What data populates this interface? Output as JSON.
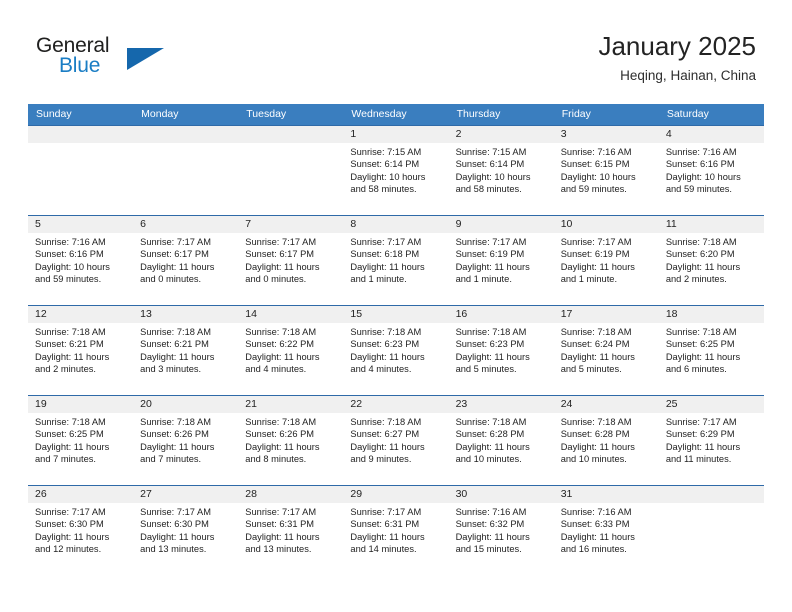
{
  "brand": {
    "name_part1": "General",
    "name_part2": "Blue",
    "triangle_color": "#1567ac",
    "blue_color": "#1a7dc4"
  },
  "header": {
    "title": "January 2025",
    "subtitle": "Heqing, Hainan, China"
  },
  "theme": {
    "header_row_bg": "#3a7ebf",
    "cell_divider": "#2f6aa8",
    "date_band_bg": "#f0f0f0"
  },
  "weekdays": [
    "Sunday",
    "Monday",
    "Tuesday",
    "Wednesday",
    "Thursday",
    "Friday",
    "Saturday"
  ],
  "weeks": [
    [
      {
        "date": "",
        "sunrise": "",
        "sunset": "",
        "daylight_line1": "",
        "daylight_line2": ""
      },
      {
        "date": "",
        "sunrise": "",
        "sunset": "",
        "daylight_line1": "",
        "daylight_line2": ""
      },
      {
        "date": "",
        "sunrise": "",
        "sunset": "",
        "daylight_line1": "",
        "daylight_line2": ""
      },
      {
        "date": "1",
        "sunrise": "Sunrise: 7:15 AM",
        "sunset": "Sunset: 6:14 PM",
        "daylight_line1": "Daylight: 10 hours",
        "daylight_line2": "and 58 minutes."
      },
      {
        "date": "2",
        "sunrise": "Sunrise: 7:15 AM",
        "sunset": "Sunset: 6:14 PM",
        "daylight_line1": "Daylight: 10 hours",
        "daylight_line2": "and 58 minutes."
      },
      {
        "date": "3",
        "sunrise": "Sunrise: 7:16 AM",
        "sunset": "Sunset: 6:15 PM",
        "daylight_line1": "Daylight: 10 hours",
        "daylight_line2": "and 59 minutes."
      },
      {
        "date": "4",
        "sunrise": "Sunrise: 7:16 AM",
        "sunset": "Sunset: 6:16 PM",
        "daylight_line1": "Daylight: 10 hours",
        "daylight_line2": "and 59 minutes."
      }
    ],
    [
      {
        "date": "5",
        "sunrise": "Sunrise: 7:16 AM",
        "sunset": "Sunset: 6:16 PM",
        "daylight_line1": "Daylight: 10 hours",
        "daylight_line2": "and 59 minutes."
      },
      {
        "date": "6",
        "sunrise": "Sunrise: 7:17 AM",
        "sunset": "Sunset: 6:17 PM",
        "daylight_line1": "Daylight: 11 hours",
        "daylight_line2": "and 0 minutes."
      },
      {
        "date": "7",
        "sunrise": "Sunrise: 7:17 AM",
        "sunset": "Sunset: 6:17 PM",
        "daylight_line1": "Daylight: 11 hours",
        "daylight_line2": "and 0 minutes."
      },
      {
        "date": "8",
        "sunrise": "Sunrise: 7:17 AM",
        "sunset": "Sunset: 6:18 PM",
        "daylight_line1": "Daylight: 11 hours",
        "daylight_line2": "and 1 minute."
      },
      {
        "date": "9",
        "sunrise": "Sunrise: 7:17 AM",
        "sunset": "Sunset: 6:19 PM",
        "daylight_line1": "Daylight: 11 hours",
        "daylight_line2": "and 1 minute."
      },
      {
        "date": "10",
        "sunrise": "Sunrise: 7:17 AM",
        "sunset": "Sunset: 6:19 PM",
        "daylight_line1": "Daylight: 11 hours",
        "daylight_line2": "and 1 minute."
      },
      {
        "date": "11",
        "sunrise": "Sunrise: 7:18 AM",
        "sunset": "Sunset: 6:20 PM",
        "daylight_line1": "Daylight: 11 hours",
        "daylight_line2": "and 2 minutes."
      }
    ],
    [
      {
        "date": "12",
        "sunrise": "Sunrise: 7:18 AM",
        "sunset": "Sunset: 6:21 PM",
        "daylight_line1": "Daylight: 11 hours",
        "daylight_line2": "and 2 minutes."
      },
      {
        "date": "13",
        "sunrise": "Sunrise: 7:18 AM",
        "sunset": "Sunset: 6:21 PM",
        "daylight_line1": "Daylight: 11 hours",
        "daylight_line2": "and 3 minutes."
      },
      {
        "date": "14",
        "sunrise": "Sunrise: 7:18 AM",
        "sunset": "Sunset: 6:22 PM",
        "daylight_line1": "Daylight: 11 hours",
        "daylight_line2": "and 4 minutes."
      },
      {
        "date": "15",
        "sunrise": "Sunrise: 7:18 AM",
        "sunset": "Sunset: 6:23 PM",
        "daylight_line1": "Daylight: 11 hours",
        "daylight_line2": "and 4 minutes."
      },
      {
        "date": "16",
        "sunrise": "Sunrise: 7:18 AM",
        "sunset": "Sunset: 6:23 PM",
        "daylight_line1": "Daylight: 11 hours",
        "daylight_line2": "and 5 minutes."
      },
      {
        "date": "17",
        "sunrise": "Sunrise: 7:18 AM",
        "sunset": "Sunset: 6:24 PM",
        "daylight_line1": "Daylight: 11 hours",
        "daylight_line2": "and 5 minutes."
      },
      {
        "date": "18",
        "sunrise": "Sunrise: 7:18 AM",
        "sunset": "Sunset: 6:25 PM",
        "daylight_line1": "Daylight: 11 hours",
        "daylight_line2": "and 6 minutes."
      }
    ],
    [
      {
        "date": "19",
        "sunrise": "Sunrise: 7:18 AM",
        "sunset": "Sunset: 6:25 PM",
        "daylight_line1": "Daylight: 11 hours",
        "daylight_line2": "and 7 minutes."
      },
      {
        "date": "20",
        "sunrise": "Sunrise: 7:18 AM",
        "sunset": "Sunset: 6:26 PM",
        "daylight_line1": "Daylight: 11 hours",
        "daylight_line2": "and 7 minutes."
      },
      {
        "date": "21",
        "sunrise": "Sunrise: 7:18 AM",
        "sunset": "Sunset: 6:26 PM",
        "daylight_line1": "Daylight: 11 hours",
        "daylight_line2": "and 8 minutes."
      },
      {
        "date": "22",
        "sunrise": "Sunrise: 7:18 AM",
        "sunset": "Sunset: 6:27 PM",
        "daylight_line1": "Daylight: 11 hours",
        "daylight_line2": "and 9 minutes."
      },
      {
        "date": "23",
        "sunrise": "Sunrise: 7:18 AM",
        "sunset": "Sunset: 6:28 PM",
        "daylight_line1": "Daylight: 11 hours",
        "daylight_line2": "and 10 minutes."
      },
      {
        "date": "24",
        "sunrise": "Sunrise: 7:18 AM",
        "sunset": "Sunset: 6:28 PM",
        "daylight_line1": "Daylight: 11 hours",
        "daylight_line2": "and 10 minutes."
      },
      {
        "date": "25",
        "sunrise": "Sunrise: 7:17 AM",
        "sunset": "Sunset: 6:29 PM",
        "daylight_line1": "Daylight: 11 hours",
        "daylight_line2": "and 11 minutes."
      }
    ],
    [
      {
        "date": "26",
        "sunrise": "Sunrise: 7:17 AM",
        "sunset": "Sunset: 6:30 PM",
        "daylight_line1": "Daylight: 11 hours",
        "daylight_line2": "and 12 minutes."
      },
      {
        "date": "27",
        "sunrise": "Sunrise: 7:17 AM",
        "sunset": "Sunset: 6:30 PM",
        "daylight_line1": "Daylight: 11 hours",
        "daylight_line2": "and 13 minutes."
      },
      {
        "date": "28",
        "sunrise": "Sunrise: 7:17 AM",
        "sunset": "Sunset: 6:31 PM",
        "daylight_line1": "Daylight: 11 hours",
        "daylight_line2": "and 13 minutes."
      },
      {
        "date": "29",
        "sunrise": "Sunrise: 7:17 AM",
        "sunset": "Sunset: 6:31 PM",
        "daylight_line1": "Daylight: 11 hours",
        "daylight_line2": "and 14 minutes."
      },
      {
        "date": "30",
        "sunrise": "Sunrise: 7:16 AM",
        "sunset": "Sunset: 6:32 PM",
        "daylight_line1": "Daylight: 11 hours",
        "daylight_line2": "and 15 minutes."
      },
      {
        "date": "31",
        "sunrise": "Sunrise: 7:16 AM",
        "sunset": "Sunset: 6:33 PM",
        "daylight_line1": "Daylight: 11 hours",
        "daylight_line2": "and 16 minutes."
      },
      {
        "date": "",
        "sunrise": "",
        "sunset": "",
        "daylight_line1": "",
        "daylight_line2": ""
      }
    ]
  ]
}
